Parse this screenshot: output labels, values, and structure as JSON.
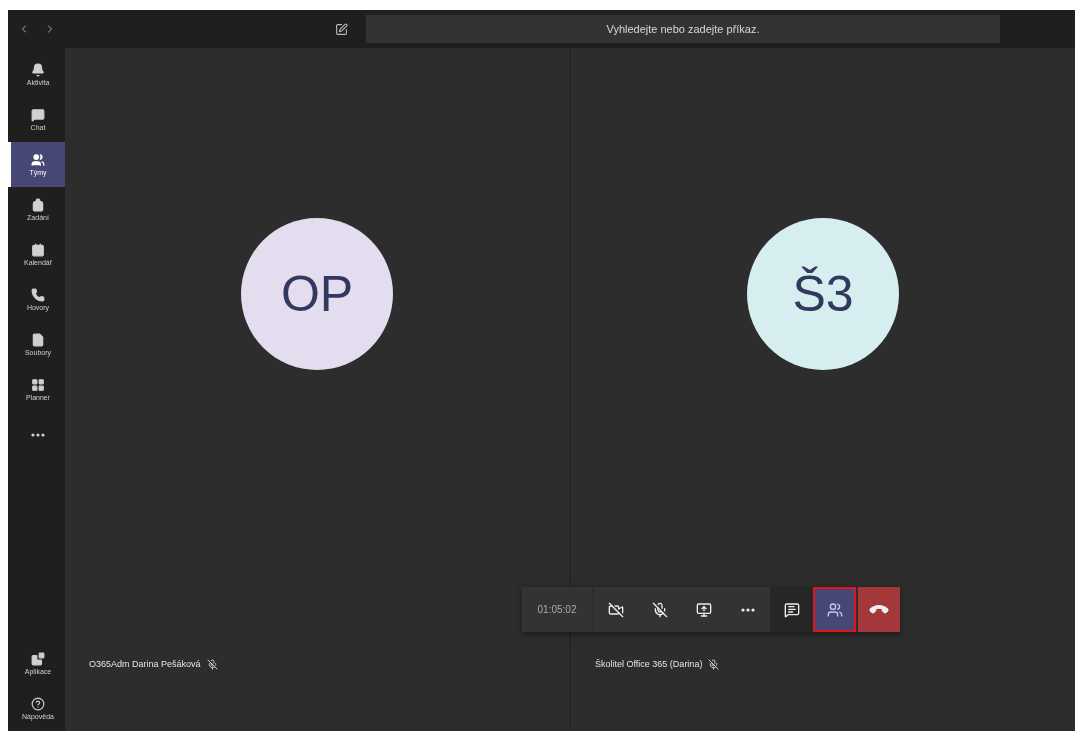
{
  "sidebar": {
    "items": [
      {
        "kind": "bell",
        "label": "Aktivita",
        "selected": false
      },
      {
        "kind": "chat",
        "label": "Chat",
        "selected": false
      },
      {
        "kind": "teams",
        "label": "Týmy",
        "selected": true
      },
      {
        "kind": "assignments",
        "label": "Zadání",
        "selected": false
      },
      {
        "kind": "calendar",
        "label": "Kalendář",
        "selected": false
      },
      {
        "kind": "calls",
        "label": "Hovory",
        "selected": false
      },
      {
        "kind": "files",
        "label": "Soubory",
        "selected": false
      },
      {
        "kind": "planner",
        "label": "Planner",
        "selected": false
      },
      {
        "kind": "more"
      }
    ],
    "bottom_items": [
      {
        "kind": "apps",
        "label": "Aplikace",
        "selected": false
      },
      {
        "kind": "help",
        "label": "Nápověda",
        "selected": false
      }
    ]
  },
  "search": {
    "placeholder": "Vyhledejte nebo zadejte příkaz."
  },
  "participants": [
    {
      "initials": "OP",
      "name": "O365Adm Darina Pešáková",
      "muted": true,
      "color": "#e3ddef"
    },
    {
      "initials": "Š3",
      "name": "Školitel Office 365 (Darina)",
      "muted": true,
      "color": "#d6eef0"
    }
  ],
  "call_controls": {
    "timer": "01:05:02",
    "buttons": [
      {
        "kind": "video_off",
        "highlighted": false
      },
      {
        "kind": "mic_off",
        "highlighted": false
      },
      {
        "kind": "share",
        "highlighted": false
      },
      {
        "kind": "more",
        "highlighted": false
      },
      {
        "kind": "chat",
        "highlighted": false
      },
      {
        "kind": "participants",
        "highlighted": true
      },
      {
        "kind": "hangup",
        "highlighted": false
      }
    ]
  }
}
